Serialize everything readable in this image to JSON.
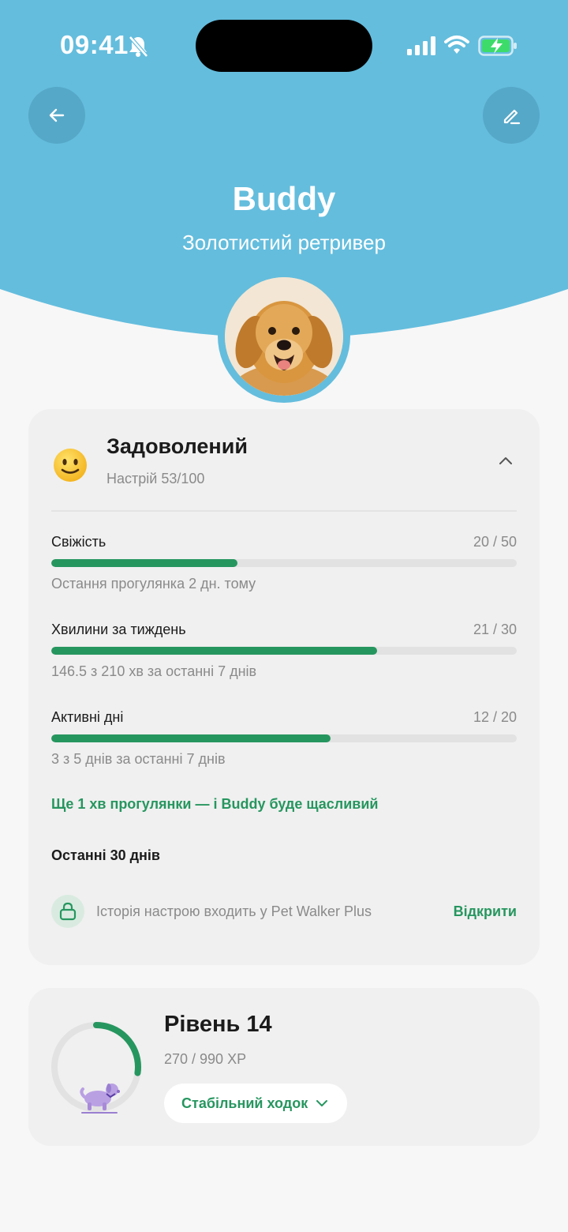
{
  "status_bar": {
    "time": "09:41"
  },
  "header": {
    "pet_name": "Buddy",
    "breed": "Золотистий ретривер"
  },
  "mood": {
    "title": "Задоволений",
    "subtitle": "Настрій 53/100",
    "metrics": [
      {
        "label": "Свіжість",
        "value": "20 / 50",
        "fill": 0.4,
        "note": "Остання прогулянка 2 дн. тому"
      },
      {
        "label": "Хвилини за тиждень",
        "value": "21 / 30",
        "fill": 0.7,
        "note": "146.5 з 210 хв за останні 7 днів"
      },
      {
        "label": "Активні дні",
        "value": "12 / 20",
        "fill": 0.6,
        "note": "3 з 5 днів за останні 7 днів"
      }
    ],
    "hint": "Ще 1 хв прогулянки — і Buddy буде щасливий",
    "history_title": "Останні 30 днів",
    "lock_text": "Історія настрою входить у Pet Walker Plus",
    "open_label": "Відкрити"
  },
  "level": {
    "title": "Рівень 14",
    "xp": "270 / 990 XP",
    "progress": 0.2727,
    "rank": "Стабільний ходок"
  },
  "colors": {
    "header_blue": "#64bddd",
    "accent_green": "#26965f",
    "card_bg": "#f0f0f0"
  },
  "icons": [
    "bell-off-icon",
    "signal-icon",
    "wifi-icon",
    "battery-charging-icon",
    "arrow-left-icon",
    "pencil-icon",
    "smile-icon",
    "chevron-up-icon",
    "lock-icon",
    "chevron-down-icon",
    "dog-icon"
  ]
}
